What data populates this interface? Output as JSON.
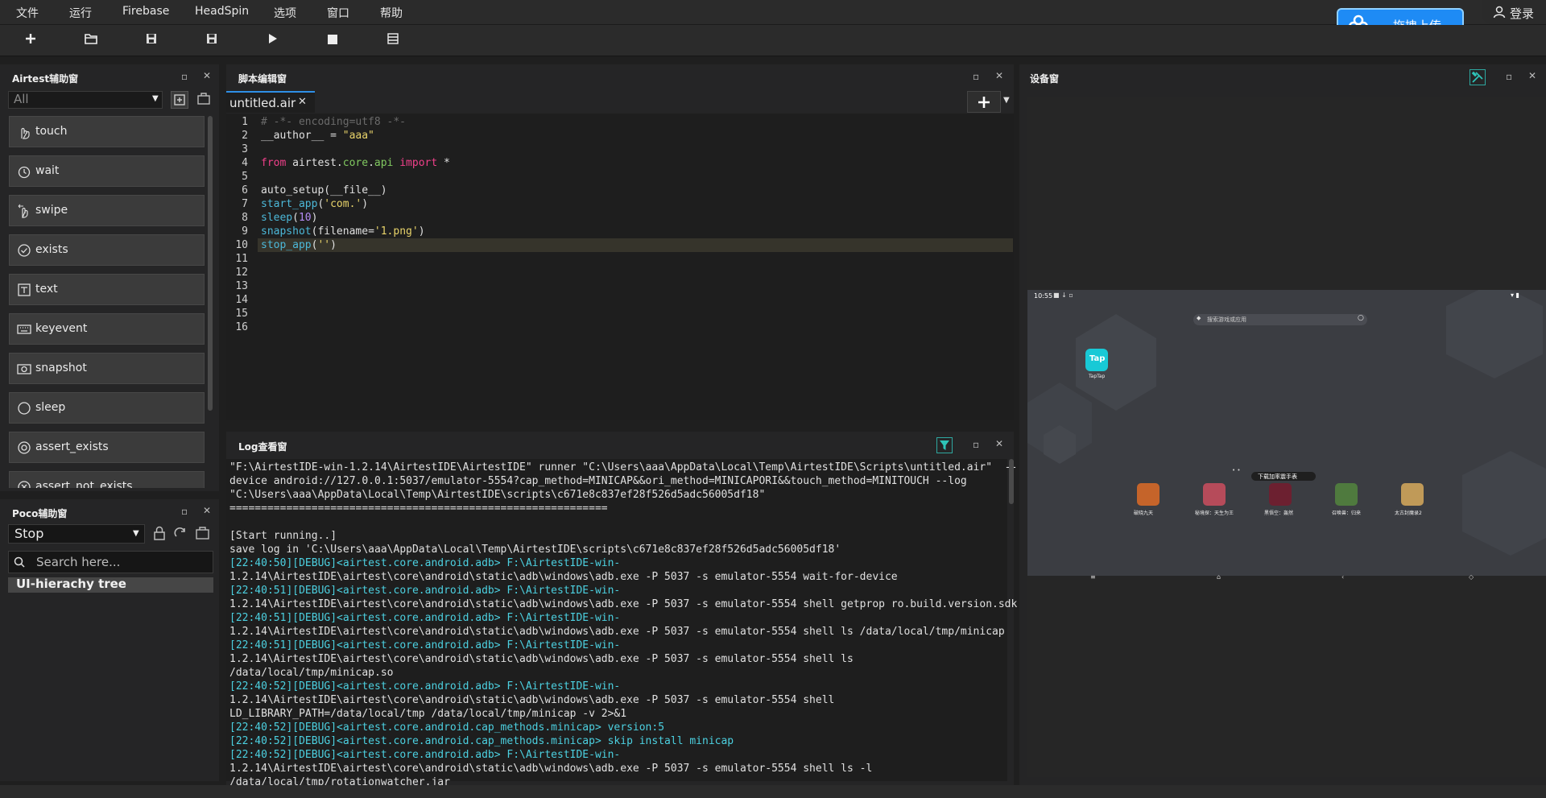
{
  "menubar": {
    "items": [
      "文件",
      "运行",
      "Firebase",
      "HeadSpin",
      "选项",
      "窗口",
      "帮助"
    ],
    "upload_label": "拖拽上传",
    "login_label": "登录"
  },
  "toolbar": {
    "icons": [
      "new-file-icon",
      "open-folder-icon",
      "save-icon",
      "save-as-icon",
      "play-icon",
      "stop-icon",
      "log-icon"
    ]
  },
  "airtest": {
    "title": "Airtest辅助窗",
    "filter_value": "All",
    "commands": [
      "touch",
      "wait",
      "swipe",
      "exists",
      "text",
      "keyevent",
      "snapshot",
      "sleep",
      "assert_exists",
      "assert_not_exists"
    ]
  },
  "poco": {
    "title": "Poco辅助窗",
    "mode_value": "Stop",
    "search_placeholder": "Search here...",
    "tree_label": "UI-hierachy tree"
  },
  "script": {
    "title": "脚本编辑窗",
    "tab_label": "untitled.air",
    "line_numbers": [
      "1",
      "2",
      "3",
      "4",
      "5",
      "6",
      "7",
      "8",
      "9",
      "10",
      "11",
      "12",
      "13",
      "14",
      "15",
      "16"
    ]
  },
  "log": {
    "title": "Log查看窗",
    "lines": [
      "\"F:\\AirtestIDE-win-1.2.14\\AirtestIDE\\AirtestIDE\" runner \"C:\\Users\\aaa\\AppData\\Local\\Temp\\AirtestIDE\\Scripts\\untitled.air\"  --",
      "device android://127.0.0.1:5037/emulator-5554?cap_method=MINICAP&&ori_method=MINICAPORI&&touch_method=MINITOUCH --log",
      "\"C:\\Users\\aaa\\AppData\\Local\\Temp\\AirtestIDE\\scripts\\c671e8c837ef28f526d5adc56005df18\"",
      "============================================================",
      "",
      "[Start running..]",
      "save log in 'C:\\Users\\aaa\\AppData\\Local\\Temp\\AirtestIDE\\scripts\\c671e8c837ef28f526d5adc56005df18'",
      "[22:40:50][DEBUG]<airtest.core.android.adb> F:\\AirtestIDE-win-",
      "1.2.14\\AirtestIDE\\airtest\\core\\android\\static\\adb\\windows\\adb.exe -P 5037 -s emulator-5554 wait-for-device",
      "[22:40:51][DEBUG]<airtest.core.android.adb> F:\\AirtestIDE-win-",
      "1.2.14\\AirtestIDE\\airtest\\core\\android\\static\\adb\\windows\\adb.exe -P 5037 -s emulator-5554 shell getprop ro.build.version.sdk",
      "[22:40:51][DEBUG]<airtest.core.android.adb> F:\\AirtestIDE-win-",
      "1.2.14\\AirtestIDE\\airtest\\core\\android\\static\\adb\\windows\\adb.exe -P 5037 -s emulator-5554 shell ls /data/local/tmp/minicap",
      "[22:40:51][DEBUG]<airtest.core.android.adb> F:\\AirtestIDE-win-",
      "1.2.14\\AirtestIDE\\airtest\\core\\android\\static\\adb\\windows\\adb.exe -P 5037 -s emulator-5554 shell ls",
      "/data/local/tmp/minicap.so",
      "[22:40:52][DEBUG]<airtest.core.android.adb> F:\\AirtestIDE-win-",
      "1.2.14\\AirtestIDE\\airtest\\core\\android\\static\\adb\\windows\\adb.exe -P 5037 -s emulator-5554 shell",
      "LD_LIBRARY_PATH=/data/local/tmp /data/local/tmp/minicap -v 2>&1",
      "[22:40:52][DEBUG]<airtest.core.android.cap_methods.minicap> version:5",
      "[22:40:52][DEBUG]<airtest.core.android.cap_methods.minicap> skip install minicap",
      "[22:40:52][DEBUG]<airtest.core.android.adb> F:\\AirtestIDE-win-",
      "1.2.14\\AirtestIDE\\airtest\\core\\android\\static\\adb\\windows\\adb.exe -P 5037 -s emulator-5554 shell ls -l",
      "/data/local/tmp/rotationwatcher.jar"
    ]
  },
  "device": {
    "title": "设备窗",
    "status_time": "10:55",
    "search_placeholder": "搜索游戏或应用",
    "tap_label": "Tap",
    "tap_app_name": "TapTap",
    "promo_label": "下载加率震手表",
    "apps": [
      "破晓九天",
      "秘境探：天生为王",
      "黑悟空：轰然",
      "召唤兽：归来",
      "太古封魔录2"
    ]
  },
  "colors": {
    "accent": "#1e8bf5",
    "keyword": "#f0408a",
    "function": "#4cb8d8",
    "string": "#e8d36a",
    "number": "#b48cf5"
  }
}
